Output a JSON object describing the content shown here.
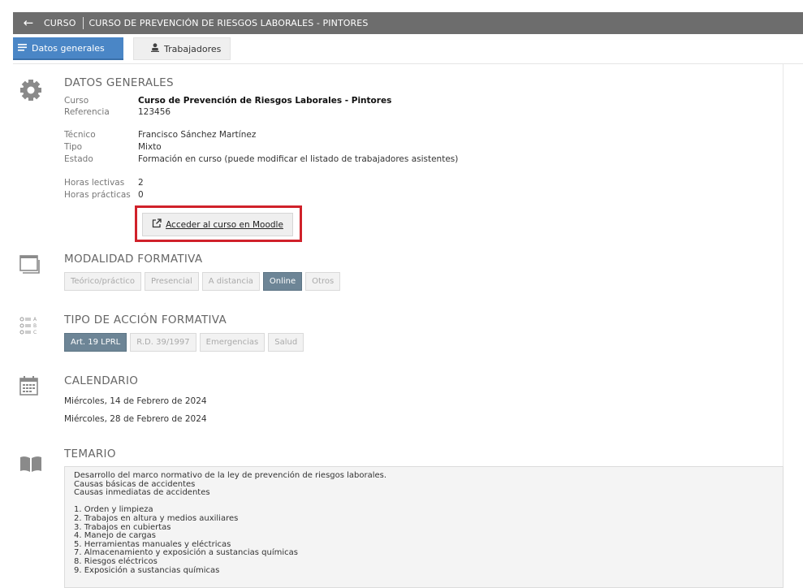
{
  "topbar": {
    "back_icon": "arrow-left-icon",
    "section": "CURSO",
    "course_title": "CURSO DE PREVENCIÓN DE RIESGOS LABORALES - PINTORES"
  },
  "tabs": [
    {
      "label": "Datos generales",
      "icon": "list-icon",
      "active": true
    },
    {
      "label": "Trabajadores",
      "icon": "worker-icon",
      "active": false
    }
  ],
  "general": {
    "title": "DATOS GENERALES",
    "curso_label": "Curso",
    "curso_value": "Curso de Prevención de Riesgos Laborales - Pintores",
    "ref_label": "Referencia",
    "ref_value": "123456",
    "tecnico_label": "Técnico",
    "tecnico_value": "Francisco Sánchez Martínez",
    "tipo_label": "Tipo",
    "tipo_value": "Mixto",
    "estado_label": "Estado",
    "estado_value": "Formación en curso (puede modificar el listado de trabajadores asistentes)",
    "horas_lectivas_label": "Horas lectivas",
    "horas_lectivas_value": "2",
    "horas_practicas_label": "Horas prácticas",
    "horas_practicas_value": "0",
    "moodle_button": "Acceder al curso en Moodle"
  },
  "modalidad": {
    "title": "MODALIDAD FORMATIVA",
    "options": [
      "Teórico/práctico",
      "Presencial",
      "A distancia",
      "Online",
      "Otros"
    ],
    "selected": "Online"
  },
  "accion": {
    "title": "TIPO DE ACCIÓN FORMATIVA",
    "options": [
      "Art. 19 LPRL",
      "R.D. 39/1997",
      "Emergencias",
      "Salud"
    ],
    "selected": "Art. 19 LPRL"
  },
  "calendario": {
    "title": "CALENDARIO",
    "dates": [
      "Miércoles, 14 de Febrero de 2024",
      "Miércoles, 28 de Febrero de 2024"
    ]
  },
  "temario": {
    "title": "TEMARIO",
    "lines": [
      "Desarrollo del marco normativo de la ley de prevención de riesgos laborales.",
      "Causas básicas de accidentes",
      "Causas inmediatas de accidentes",
      "",
      "1. Orden y limpieza",
      "2. Trabajos en altura y medios auxiliares",
      "3. Trabajos en cubiertas",
      "4. Manejo de cargas",
      "5. Herramientas manuales y eléctricas",
      "7. Almacenamiento y exposición a sustancias químicas",
      "8. Riesgos eléctricos",
      "9. Exposición a sustancias químicas"
    ]
  },
  "colors": {
    "topbar": "#6d6d6d",
    "tab_active": "#4a86c6",
    "chip_selected": "#6d8596",
    "highlight": "#d0212a"
  }
}
